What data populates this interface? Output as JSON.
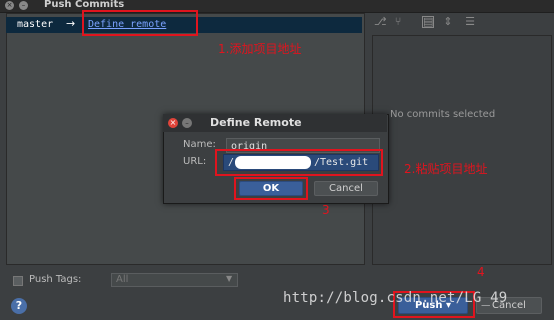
{
  "window": {
    "title": "Push Commits",
    "close_glyph": "×",
    "min_glyph": "–"
  },
  "branches": {
    "branch_name": "master",
    "arrow": "→",
    "define_remote_link": "Define remote"
  },
  "annotations": {
    "step1": "1.添加项目地址",
    "step2": "2.粘贴项目地址",
    "step3": "3",
    "step4": "4",
    "color": "#e0141e"
  },
  "commits_panel": {
    "toolbar_icons": [
      "branch-icon",
      "branch-alt-icon",
      "collapse-icon",
      "expand-icon",
      "filter-icon"
    ],
    "empty_text": "No commits selected"
  },
  "dialog": {
    "title": "Define Remote",
    "close_glyph": "×",
    "min_glyph": "–",
    "name_label": "Name:",
    "name_value": "origin",
    "url_label": "URL:",
    "url_prefix": "/",
    "url_suffix": "/Test.git",
    "ok_label": "OK",
    "cancel_label": "Cancel"
  },
  "footer": {
    "push_tags_label": "Push Tags:",
    "push_tags_selected": "All",
    "help_glyph": "?",
    "push_label": "Push",
    "push_dropdown_glyph": "▾",
    "cancel_label": "Cancel"
  },
  "watermark": "http://blog.csdn.net/LG_49",
  "colors": {
    "background": "#3c3f41",
    "selection": "#0d293e",
    "link": "#7aa2ff",
    "primary_button": "#3a5f9a"
  }
}
